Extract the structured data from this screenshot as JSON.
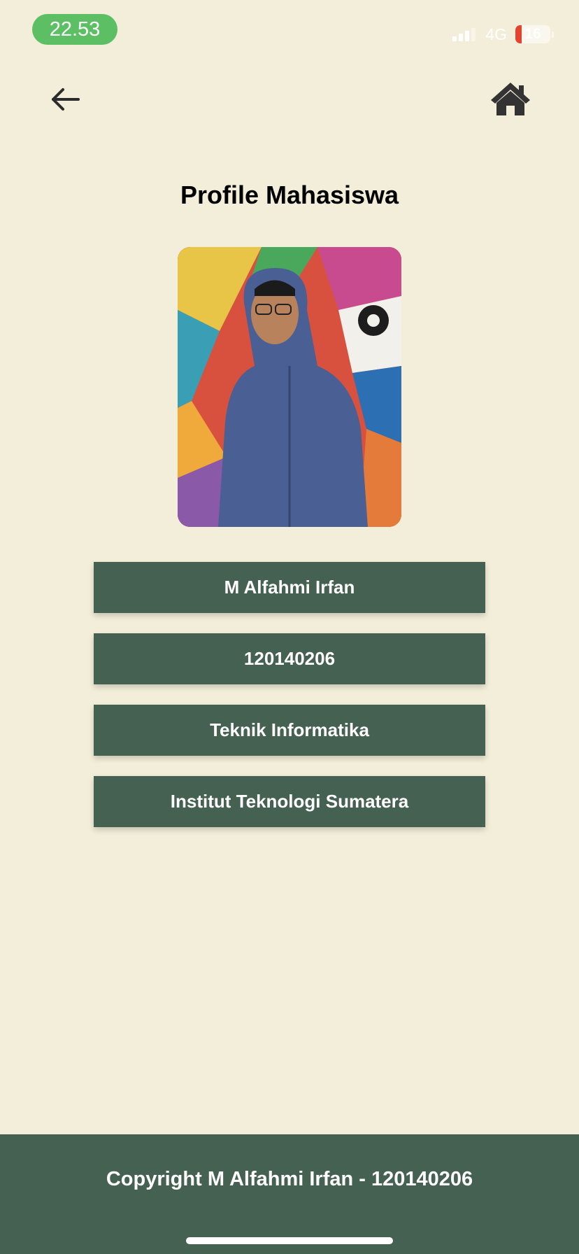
{
  "status_bar": {
    "time": "22.53",
    "network": "4G",
    "battery_level": "16",
    "time_pill_color": "#5cbf63",
    "battery_low_color": "#e4432f"
  },
  "header": {
    "back_icon": "arrow-left-icon",
    "home_icon": "home-icon"
  },
  "page": {
    "title": "Profile Mahasiswa"
  },
  "profile": {
    "name": "M Alfahmi Irfan",
    "student_id": "120140206",
    "major": "Teknik Informatika",
    "institution": "Institut Teknologi Sumatera"
  },
  "footer": {
    "copyright": "Copyright M Alfahmi Irfan - 120140206"
  },
  "colors": {
    "background": "#f3eed9",
    "accent": "#456152",
    "text_on_accent": "#ffffff"
  }
}
